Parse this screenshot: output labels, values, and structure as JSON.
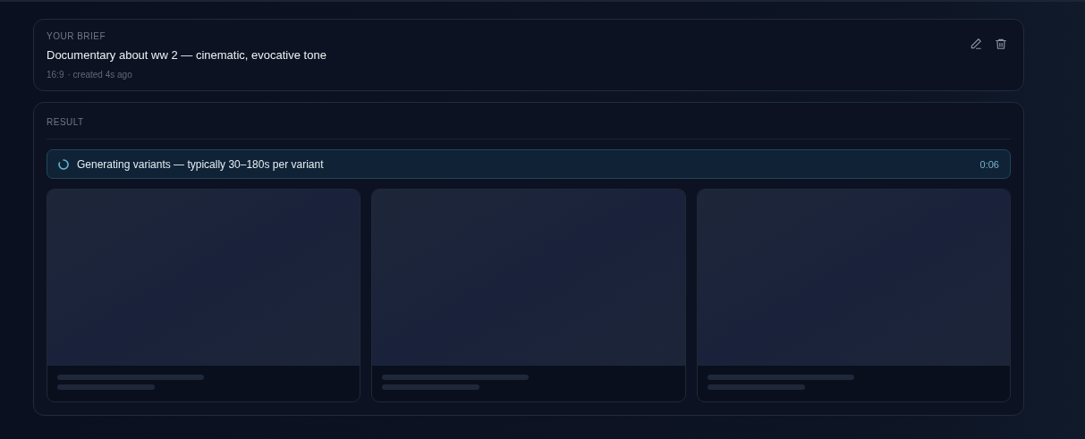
{
  "brief": {
    "label": "YOUR BRIEF",
    "title": "Documentary about ww 2 — cinematic, evocative tone",
    "aspect": "16:9",
    "created": "· created 4s ago"
  },
  "result": {
    "label": "RESULT",
    "status": {
      "text": "Generating variants — typically 30–180s per variant",
      "elapsed": "0:06",
      "loading": true
    },
    "variants": [
      {
        "kind": "placeholder"
      },
      {
        "kind": "placeholder"
      },
      {
        "kind": "placeholder"
      }
    ]
  }
}
